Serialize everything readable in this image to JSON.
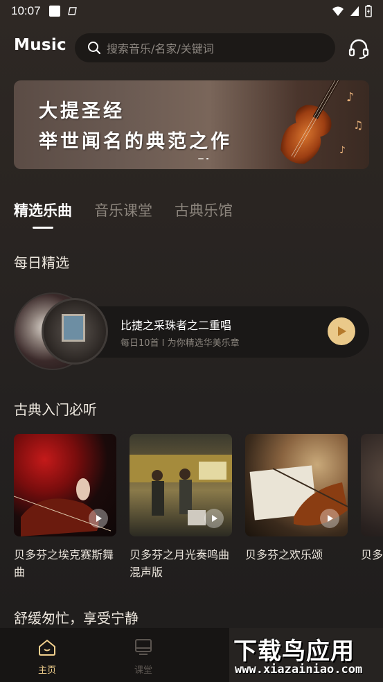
{
  "status_bar": {
    "time": "10:07"
  },
  "header": {
    "logo": "Music",
    "search_placeholder": "搜索音乐/名家/关键词"
  },
  "banner": {
    "line1": "大提圣经",
    "line2": "举世闻名的典范之作"
  },
  "tabs": [
    {
      "label": "精选乐曲",
      "active": true
    },
    {
      "label": "音乐课堂",
      "active": false
    },
    {
      "label": "古典乐馆",
      "active": false
    }
  ],
  "daily": {
    "section_title": "每日精选",
    "title": "比捷之采珠者之二重唱",
    "subtitle": "每日10首 I 为你精选华美乐章"
  },
  "classics": {
    "section_title": "古典入门必听",
    "cards": [
      {
        "title": "贝多芬之埃克赛斯舞曲"
      },
      {
        "title": "贝多芬之月光奏鸣曲混声版"
      },
      {
        "title": "贝多芬之欢乐颂"
      },
      {
        "title": "贝多芬之乐第"
      }
    ]
  },
  "relax": {
    "section_title": "舒缓匆忙，享受宁静"
  },
  "bottom_nav": [
    {
      "label": "主页",
      "active": true,
      "icon": "home-icon"
    },
    {
      "label": "课堂",
      "active": false,
      "icon": "classroom-icon"
    }
  ],
  "watermark": {
    "main": "下载鸟应用",
    "url": "www.xiazainiao.com"
  },
  "colors": {
    "accent": "#eac98a",
    "active_nav": "#f2d08e",
    "inactive_nav": "#5b5550"
  }
}
